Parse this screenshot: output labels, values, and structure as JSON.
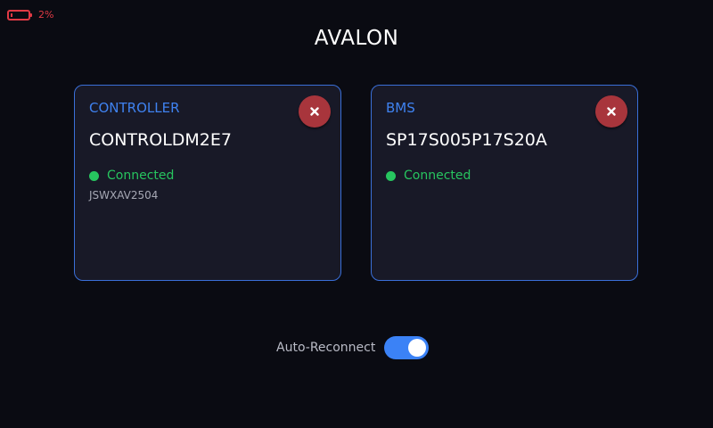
{
  "status_bar": {
    "battery_percent": "2%",
    "battery_icon": "battery-low-icon",
    "battery_color": "#e03a45"
  },
  "header": {
    "title": "AVALON"
  },
  "cards": [
    {
      "label": "CONTROLLER",
      "name": "CONTROLDM2E7",
      "status": "Connected",
      "detail": "JSWXAV2504",
      "close_icon": "close-icon"
    },
    {
      "label": "BMS",
      "name": "SP17S005P17S20A",
      "status": "Connected",
      "close_icon": "close-icon"
    }
  ],
  "auto_reconnect": {
    "label": "Auto-Reconnect",
    "enabled": true
  },
  "colors": {
    "accent": "#3f82f0",
    "connected": "#27c55f",
    "close_button": "#a8353c",
    "background": "#0a0b12",
    "card_background": "#181927"
  }
}
